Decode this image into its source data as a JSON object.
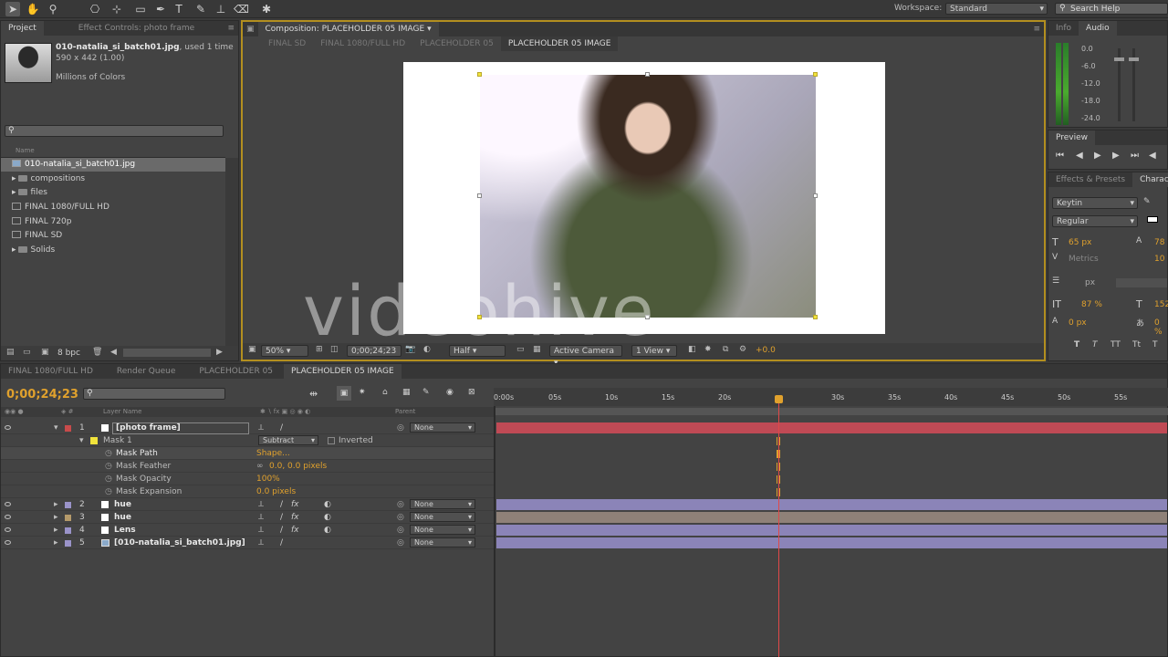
{
  "toolbar": {
    "workspace_label": "Workspace:",
    "workspace_value": "Standard",
    "search_placeholder": "Search Help"
  },
  "project_panel": {
    "tabs": [
      "Project",
      "Effect Controls: photo frame"
    ],
    "item_name": "010-natalia_si_batch01.jpg",
    "item_usage": ", used 1 time",
    "item_dims": "590 x 442 (1.00)",
    "item_colors": "Millions of Colors",
    "column_name": "Name",
    "items": [
      {
        "label": "010-natalia_si_batch01.jpg",
        "type": "image",
        "selected": true
      },
      {
        "label": "compositions",
        "type": "folder"
      },
      {
        "label": "files",
        "type": "folder"
      },
      {
        "label": "FINAL 1080/FULL HD",
        "type": "comp"
      },
      {
        "label": "FINAL 720p",
        "type": "comp"
      },
      {
        "label": "FINAL SD",
        "type": "comp"
      },
      {
        "label": "Solids",
        "type": "folder"
      }
    ],
    "bpc": "8 bpc"
  },
  "composition_panel": {
    "title": "Composition: PLACEHOLDER 05 IMAGE",
    "subtabs": [
      "FINAL SD",
      "FINAL 1080/FULL HD",
      "PLACEHOLDER 05",
      "PLACEHOLDER 05 IMAGE"
    ],
    "active_subtab": "PLACEHOLDER 05 IMAGE",
    "zoom": "50%",
    "timecode": "0;00;24;23",
    "resolution": "Half",
    "camera": "Active Camera",
    "views": "1 View",
    "exposure": "+0.0",
    "watermark": "videohive"
  },
  "info_panel": {
    "tabs": [
      "Info",
      "Audio"
    ],
    "db_levels": [
      "0.0",
      "-6.0",
      "-12.0",
      "-18.0",
      "-24.0"
    ]
  },
  "preview_panel": {
    "title": "Preview"
  },
  "effects_panel": {
    "tabs": [
      "Effects & Presets",
      "Charac"
    ],
    "font": "Keytin",
    "style": "Regular",
    "size": "65 px",
    "leading": "78",
    "kerning": "Metrics",
    "tracking": "10",
    "stroke": "px",
    "vscale": "87 %",
    "hscale": "152",
    "baseline": "0 px",
    "tsume": "0 %"
  },
  "timeline": {
    "tabs": [
      "FINAL 1080/FULL HD",
      "Render Queue",
      "PLACEHOLDER 05",
      "PLACEHOLDER 05 IMAGE"
    ],
    "active_tab": "PLACEHOLDER 05 IMAGE",
    "current_time": "0;00;24;23",
    "col_layer_name": "Layer Name",
    "col_parent": "Parent",
    "ruler": [
      "0:00s",
      "05s",
      "10s",
      "15s",
      "20s",
      "30s",
      "35s",
      "40s",
      "45s",
      "50s",
      "55s"
    ],
    "layers": [
      {
        "num": "1",
        "name": "[photo frame]",
        "parent": "None",
        "color": "#c84b4b",
        "bar_color": "#c04a55"
      },
      {
        "num": "2",
        "name": "hue",
        "parent": "None",
        "color": "#9a93c9",
        "bar_color": "#8b84b8"
      },
      {
        "num": "3",
        "name": "hue",
        "parent": "None",
        "color": "#b59a6a",
        "bar_color": "#8b84b8"
      },
      {
        "num": "4",
        "name": "Lens",
        "parent": "None",
        "color": "#9a93c9",
        "bar_color": "#8b84b8"
      },
      {
        "num": "5",
        "name": "[010-natalia_si_batch01.jpg]",
        "parent": "None",
        "color": "#9a93c9",
        "bar_color": "#8b84b8"
      }
    ],
    "mask": {
      "name": "Mask 1",
      "mode": "Subtract",
      "inverted_label": "Inverted",
      "props": [
        {
          "name": "Mask Path",
          "value": "Shape..."
        },
        {
          "name": "Mask Feather",
          "value": "0.0, 0.0 pixels"
        },
        {
          "name": "Mask Opacity",
          "value": "100%"
        },
        {
          "name": "Mask Expansion",
          "value": "0.0 pixels"
        }
      ]
    }
  }
}
